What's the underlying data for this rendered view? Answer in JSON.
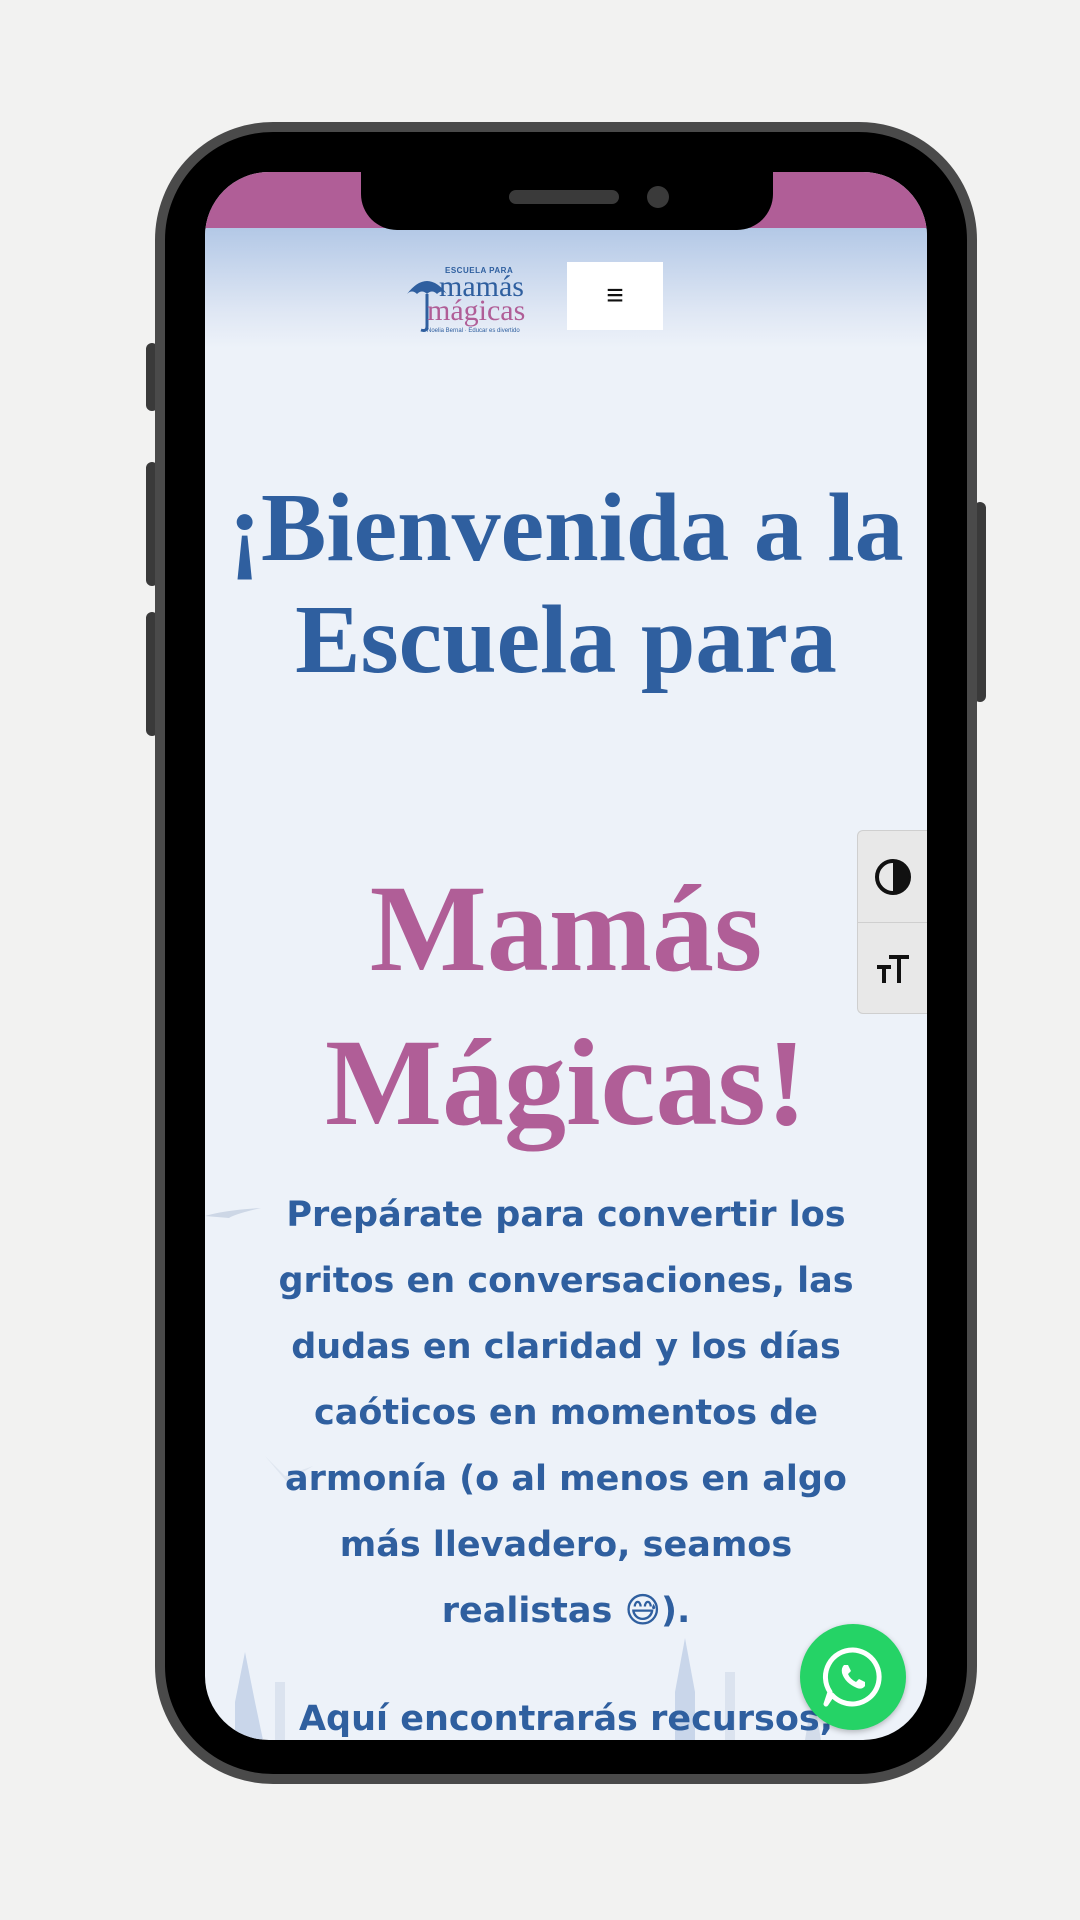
{
  "header": {
    "logo": {
      "top_small": "ESCUELA PARA",
      "word1": "mamás",
      "word2": "mágicas",
      "tagline": "Noelia Bernal · Educar es divertido"
    },
    "menu_glyph": "≡"
  },
  "hero": {
    "title_line1": "¡Bienvenida a la Escuela para",
    "title_line2": "Mamás Mágicas!",
    "paragraph": "Prepárate para convertir los gritos en conversaciones, las dudas en claridad y los días caóticos en momentos de armonía (o al menos en algo más llevadero, seamos realistas 😅).",
    "paragraph2": "Aquí encontrarás recursos,"
  },
  "accessibility": {
    "contrast_icon": "contrast-icon",
    "font_size_icon": "text-size-icon"
  },
  "whatsapp": {
    "icon": "whatsapp-icon"
  },
  "colors": {
    "brand_blue": "#2f5f9f",
    "brand_pink": "#b05e97",
    "whatsapp_green": "#25d366",
    "background": "#edf2f9"
  }
}
